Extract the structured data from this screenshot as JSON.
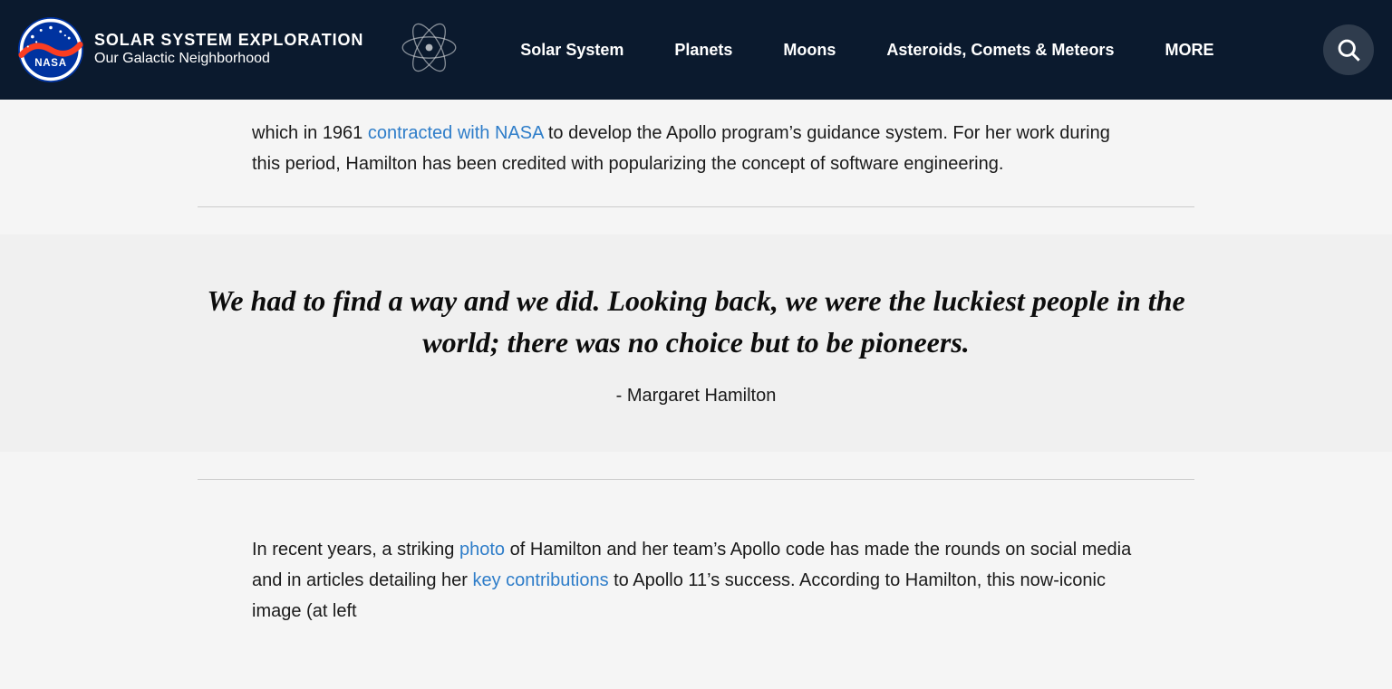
{
  "header": {
    "logo_alt": "NASA",
    "site_title": "SOLAR SYSTEM EXPLORATION",
    "site_subtitle": "Our Galactic Neighborhood",
    "nav_items": [
      {
        "label": "Solar System",
        "id": "solar-system"
      },
      {
        "label": "Planets",
        "id": "planets"
      },
      {
        "label": "Moons",
        "id": "moons"
      },
      {
        "label": "Asteroids, Comets & Meteors",
        "id": "asteroids"
      },
      {
        "label": "MORE",
        "id": "more"
      }
    ],
    "search_label": "Search"
  },
  "article": {
    "intro_paragraph": {
      "text_before_link": "which in 1961 ",
      "link_text": "contracted with NASA",
      "link_href": "#",
      "text_after_link": " to develop the Apollo program’s guidance system. For her work during this period, Hamilton has been credited with popularizing the concept of software engineering."
    },
    "quote": {
      "text": "We had to find a way and we did. Looking back, we were the luckiest people in the world; there was no choice but to be pioneers.",
      "attribution": "- Margaret Hamilton"
    },
    "lower_paragraph": {
      "text_before_link1": "In recent years, a striking ",
      "link1_text": "photo",
      "link1_href": "#",
      "text_after_link1": " of Hamilton and her team’s Apollo code has made the rounds on social media and in articles detailing her ",
      "link2_text": "key contributions",
      "link2_href": "#",
      "text_after_link2": " to Apollo 11’s success. According to Hamilton, this now-iconic image (at left"
    }
  },
  "colors": {
    "header_bg": "#0b1a2e",
    "link_color": "#2e7dc9",
    "text_color": "#1a1a1a",
    "background": "#f5f5f5"
  }
}
